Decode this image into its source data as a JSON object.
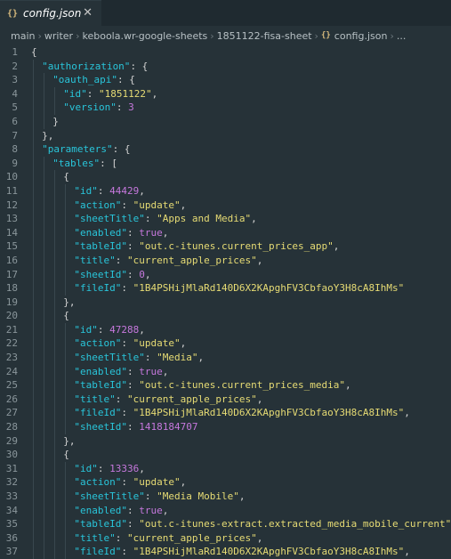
{
  "tab": {
    "label": "config.json",
    "icon": "json-icon"
  },
  "breadcrumb": [
    "main",
    "writer",
    "keboola.wr-google-sheets",
    "1851122-fisa-sheet",
    "config.json",
    "..."
  ],
  "colors": {
    "key": "#29c5da",
    "string": "#e6db74",
    "number": "#c678dd",
    "background": "#263238"
  },
  "lines": [
    {
      "n": "1",
      "d": 0,
      "t": [
        [
          "p",
          "{"
        ]
      ]
    },
    {
      "n": "2",
      "d": 1,
      "t": [
        [
          "k",
          "\"authorization\""
        ],
        [
          "p",
          ": {"
        ]
      ]
    },
    {
      "n": "3",
      "d": 2,
      "t": [
        [
          "k",
          "\"oauth_api\""
        ],
        [
          "p",
          ": {"
        ]
      ]
    },
    {
      "n": "4",
      "d": 3,
      "t": [
        [
          "k",
          "\"id\""
        ],
        [
          "p",
          ": "
        ],
        [
          "s",
          "\"1851122\""
        ],
        [
          "p",
          ","
        ]
      ]
    },
    {
      "n": "5",
      "d": 3,
      "t": [
        [
          "k",
          "\"version\""
        ],
        [
          "p",
          ": "
        ],
        [
          "n",
          "3"
        ]
      ]
    },
    {
      "n": "6",
      "d": 2,
      "t": [
        [
          "p",
          "}"
        ]
      ]
    },
    {
      "n": "7",
      "d": 1,
      "t": [
        [
          "p",
          "},"
        ]
      ]
    },
    {
      "n": "8",
      "d": 1,
      "t": [
        [
          "k",
          "\"parameters\""
        ],
        [
          "p",
          ": {"
        ]
      ]
    },
    {
      "n": "9",
      "d": 2,
      "t": [
        [
          "k",
          "\"tables\""
        ],
        [
          "p",
          ": ["
        ]
      ]
    },
    {
      "n": "10",
      "d": 3,
      "t": [
        [
          "p",
          "{"
        ]
      ]
    },
    {
      "n": "11",
      "d": 4,
      "t": [
        [
          "k",
          "\"id\""
        ],
        [
          "p",
          ": "
        ],
        [
          "n",
          "44429"
        ],
        [
          "p",
          ","
        ]
      ]
    },
    {
      "n": "12",
      "d": 4,
      "t": [
        [
          "k",
          "\"action\""
        ],
        [
          "p",
          ": "
        ],
        [
          "s",
          "\"update\""
        ],
        [
          "p",
          ","
        ]
      ]
    },
    {
      "n": "13",
      "d": 4,
      "t": [
        [
          "k",
          "\"sheetTitle\""
        ],
        [
          "p",
          ": "
        ],
        [
          "s",
          "\"Apps and Media\""
        ],
        [
          "p",
          ","
        ]
      ]
    },
    {
      "n": "14",
      "d": 4,
      "t": [
        [
          "k",
          "\"enabled\""
        ],
        [
          "p",
          ": "
        ],
        [
          "b",
          "true"
        ],
        [
          "p",
          ","
        ]
      ]
    },
    {
      "n": "15",
      "d": 4,
      "t": [
        [
          "k",
          "\"tableId\""
        ],
        [
          "p",
          ": "
        ],
        [
          "s",
          "\"out.c-itunes.current_prices_app\""
        ],
        [
          "p",
          ","
        ]
      ]
    },
    {
      "n": "16",
      "d": 4,
      "t": [
        [
          "k",
          "\"title\""
        ],
        [
          "p",
          ": "
        ],
        [
          "s",
          "\"current_apple_prices\""
        ],
        [
          "p",
          ","
        ]
      ]
    },
    {
      "n": "17",
      "d": 4,
      "t": [
        [
          "k",
          "\"sheetId\""
        ],
        [
          "p",
          ": "
        ],
        [
          "n",
          "0"
        ],
        [
          "p",
          ","
        ]
      ]
    },
    {
      "n": "18",
      "d": 4,
      "t": [
        [
          "k",
          "\"fileId\""
        ],
        [
          "p",
          ": "
        ],
        [
          "s",
          "\"1B4PSHijMlaRd140D6X2KApghFV3CbfaoY3H8cA8IhMs\""
        ]
      ]
    },
    {
      "n": "19",
      "d": 3,
      "t": [
        [
          "p",
          "},"
        ]
      ]
    },
    {
      "n": "20",
      "d": 3,
      "t": [
        [
          "p",
          "{"
        ]
      ]
    },
    {
      "n": "21",
      "d": 4,
      "t": [
        [
          "k",
          "\"id\""
        ],
        [
          "p",
          ": "
        ],
        [
          "n",
          "47288"
        ],
        [
          "p",
          ","
        ]
      ]
    },
    {
      "n": "22",
      "d": 4,
      "t": [
        [
          "k",
          "\"action\""
        ],
        [
          "p",
          ": "
        ],
        [
          "s",
          "\"update\""
        ],
        [
          "p",
          ","
        ]
      ]
    },
    {
      "n": "23",
      "d": 4,
      "t": [
        [
          "k",
          "\"sheetTitle\""
        ],
        [
          "p",
          ": "
        ],
        [
          "s",
          "\"Media\""
        ],
        [
          "p",
          ","
        ]
      ]
    },
    {
      "n": "24",
      "d": 4,
      "t": [
        [
          "k",
          "\"enabled\""
        ],
        [
          "p",
          ": "
        ],
        [
          "b",
          "true"
        ],
        [
          "p",
          ","
        ]
      ]
    },
    {
      "n": "25",
      "d": 4,
      "t": [
        [
          "k",
          "\"tableId\""
        ],
        [
          "p",
          ": "
        ],
        [
          "s",
          "\"out.c-itunes.current_prices_media\""
        ],
        [
          "p",
          ","
        ]
      ]
    },
    {
      "n": "26",
      "d": 4,
      "t": [
        [
          "k",
          "\"title\""
        ],
        [
          "p",
          ": "
        ],
        [
          "s",
          "\"current_apple_prices\""
        ],
        [
          "p",
          ","
        ]
      ]
    },
    {
      "n": "27",
      "d": 4,
      "t": [
        [
          "k",
          "\"fileId\""
        ],
        [
          "p",
          ": "
        ],
        [
          "s",
          "\"1B4PSHijMlaRd140D6X2KApghFV3CbfaoY3H8cA8IhMs\""
        ],
        [
          "p",
          ","
        ]
      ]
    },
    {
      "n": "28",
      "d": 4,
      "t": [
        [
          "k",
          "\"sheetId\""
        ],
        [
          "p",
          ": "
        ],
        [
          "n",
          "1418184707"
        ]
      ]
    },
    {
      "n": "29",
      "d": 3,
      "t": [
        [
          "p",
          "},"
        ]
      ]
    },
    {
      "n": "30",
      "d": 3,
      "t": [
        [
          "p",
          "{"
        ]
      ]
    },
    {
      "n": "31",
      "d": 4,
      "t": [
        [
          "k",
          "\"id\""
        ],
        [
          "p",
          ": "
        ],
        [
          "n",
          "13336"
        ],
        [
          "p",
          ","
        ]
      ]
    },
    {
      "n": "32",
      "d": 4,
      "t": [
        [
          "k",
          "\"action\""
        ],
        [
          "p",
          ": "
        ],
        [
          "s",
          "\"update\""
        ],
        [
          "p",
          ","
        ]
      ]
    },
    {
      "n": "33",
      "d": 4,
      "t": [
        [
          "k",
          "\"sheetTitle\""
        ],
        [
          "p",
          ": "
        ],
        [
          "s",
          "\"Media Mobile\""
        ],
        [
          "p",
          ","
        ]
      ]
    },
    {
      "n": "34",
      "d": 4,
      "t": [
        [
          "k",
          "\"enabled\""
        ],
        [
          "p",
          ": "
        ],
        [
          "b",
          "true"
        ],
        [
          "p",
          ","
        ]
      ]
    },
    {
      "n": "35",
      "d": 4,
      "t": [
        [
          "k",
          "\"tableId\""
        ],
        [
          "p",
          ": "
        ],
        [
          "s",
          "\"out.c-itunes-extract.extracted_media_mobile_current\""
        ],
        [
          "p",
          ","
        ]
      ]
    },
    {
      "n": "36",
      "d": 4,
      "t": [
        [
          "k",
          "\"title\""
        ],
        [
          "p",
          ": "
        ],
        [
          "s",
          "\"current_apple_prices\""
        ],
        [
          "p",
          ","
        ]
      ]
    },
    {
      "n": "37",
      "d": 4,
      "t": [
        [
          "k",
          "\"fileId\""
        ],
        [
          "p",
          ": "
        ],
        [
          "s",
          "\"1B4PSHijMlaRd140D6X2KApghFV3CbfaoY3H8cA8IhMs\""
        ],
        [
          "p",
          ","
        ]
      ]
    }
  ]
}
